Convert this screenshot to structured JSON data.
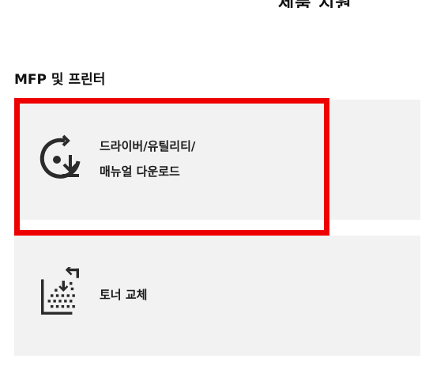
{
  "header": {
    "heading_fragment": "제품 지원"
  },
  "section": {
    "title": "MFP 및 프린터"
  },
  "cards": [
    {
      "label_line1": "드라이버/유틸리티/",
      "label_line2": "매뉴얼 다운로드",
      "icon": "download-refresh-icon"
    },
    {
      "label_line1": "토너 교체",
      "icon": "toner-replace-icon"
    }
  ],
  "colors": {
    "highlight": "#ee0000",
    "card_background": "#f2f2f2",
    "icon": "#2b2b2b"
  }
}
